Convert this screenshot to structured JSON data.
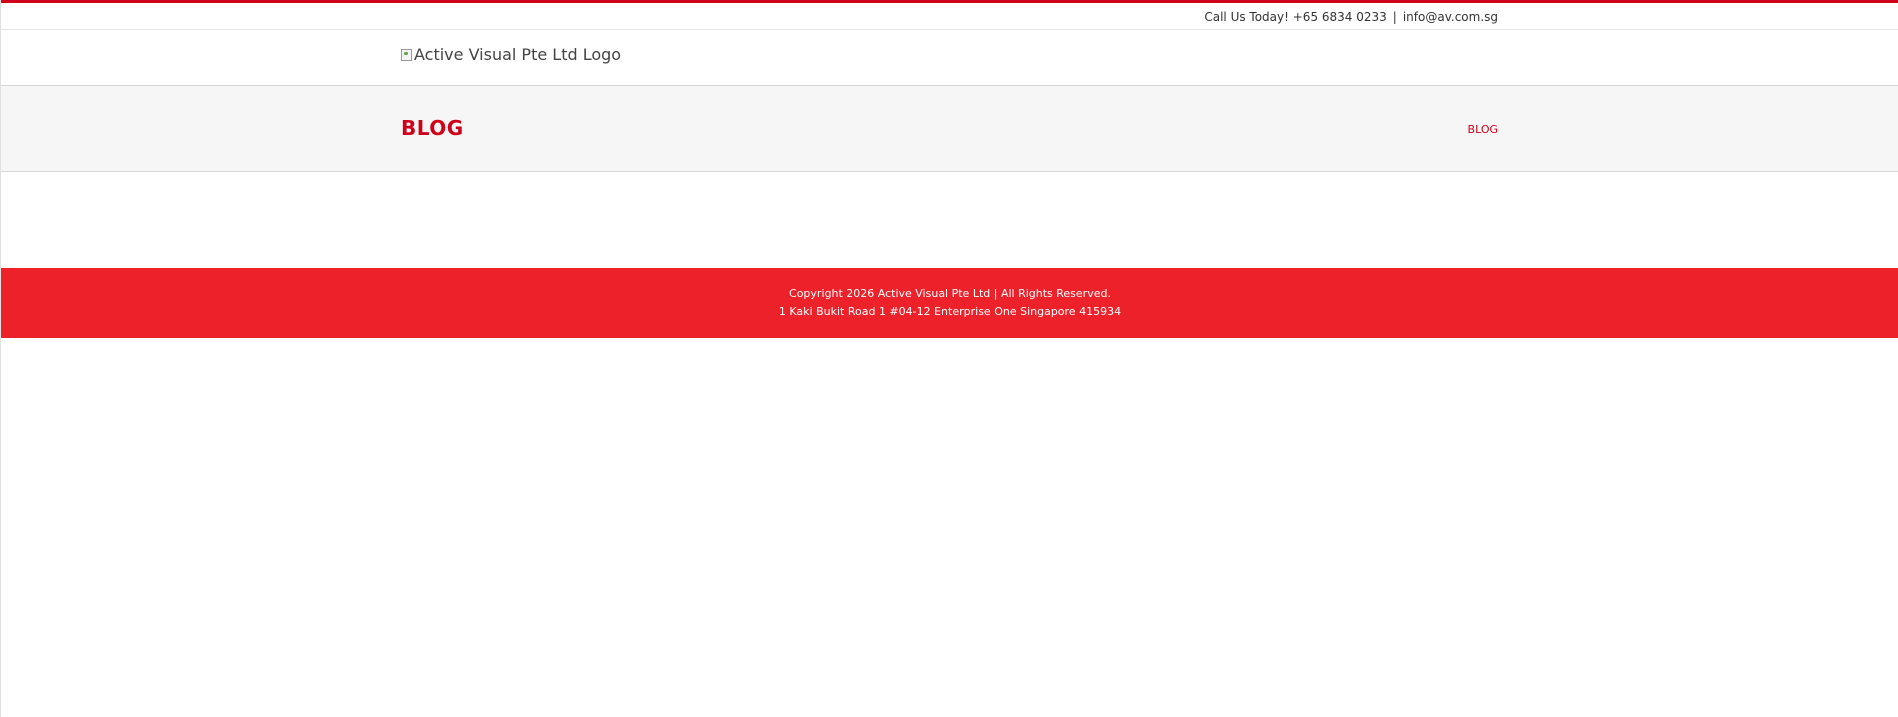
{
  "topbar": {
    "call_text": "Call Us Today! +65 6834 0233",
    "separator": "|",
    "email": "info@av.com.sg"
  },
  "header": {
    "logo_alt": "Active Visual Pte Ltd Logo"
  },
  "title_bar": {
    "title": "BLOG",
    "breadcrumb": "BLOG"
  },
  "footer": {
    "copyright": "Copyright 2026 Active Visual Pte Ltd | All Rights Reserved.",
    "address": "1 Kaki Bukit Road 1 #04-12 Enterprise One Singapore 415934"
  },
  "colors": {
    "accent": "#d0021b",
    "footer_bg": "#ed2129",
    "title_bar_bg": "#f6f6f6"
  }
}
